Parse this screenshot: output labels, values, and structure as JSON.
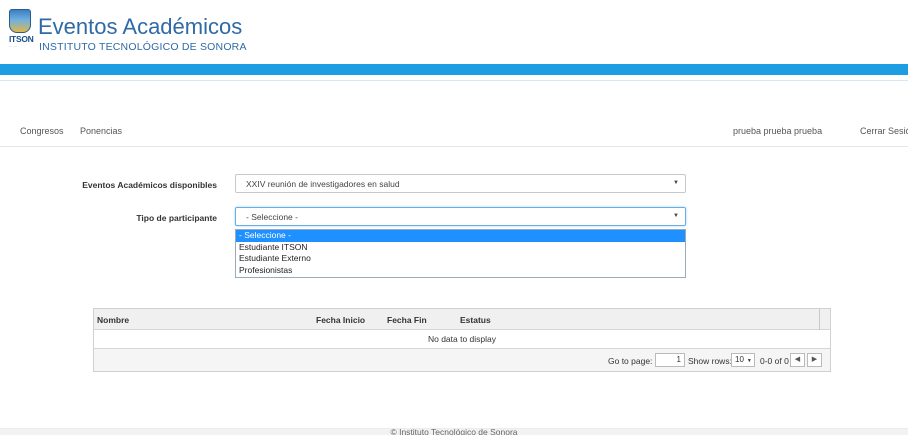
{
  "header": {
    "logo_text": "ITSON",
    "title": "Eventos Académicos",
    "subtitle": "INSTITUTO TECNOLÓGICO DE SONORA",
    "accent_color": "#1e9ee2"
  },
  "nav": {
    "left": [
      "Congresos",
      "Ponencias"
    ],
    "user": "prueba prueba prueba",
    "logout": "Cerrar Sesión"
  },
  "form": {
    "event_label": "Eventos Académicos disponibles",
    "event_value": "XXIV reunión de investigadores en salud",
    "participant_label": "Tipo de participante",
    "participant_value": "- Seleccione -",
    "participant_options": [
      "- Seleccione -",
      "Estudiante ITSON",
      "Estudiante Externo",
      "Profesionistas"
    ]
  },
  "grid": {
    "columns": [
      "Nombre",
      "Fecha Inicio",
      "Fecha Fin",
      "Estatus"
    ],
    "empty_text": "No data to display",
    "pager": {
      "go_to_page": "Go to page:",
      "page": "1",
      "show_rows": "Show rows:",
      "rows": "10",
      "range": "0-0 of 0"
    }
  },
  "footer": "© Instituto Tecnológico de Sonora"
}
